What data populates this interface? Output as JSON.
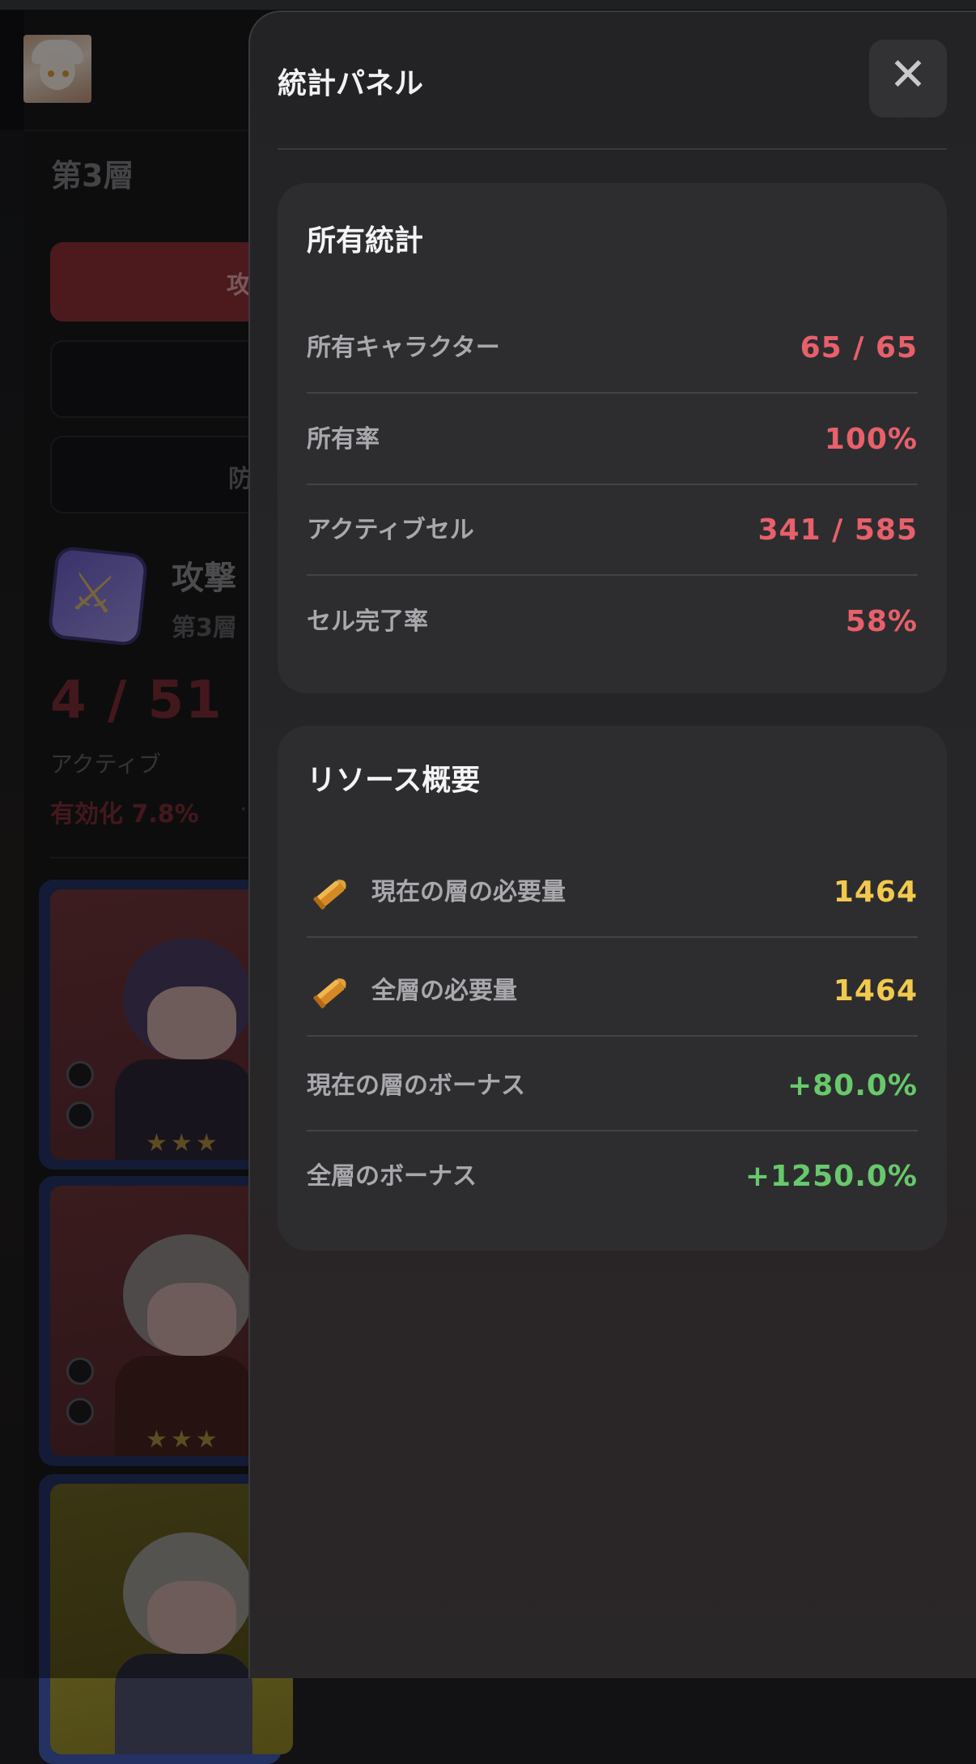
{
  "background": {
    "layer_title": "第3層",
    "buttons": [
      "攻",
      "",
      "防"
    ],
    "skill": {
      "name": "攻撃",
      "sub": "第3層"
    },
    "count": "4 / 51",
    "active_label": "アクティブ",
    "enabled_text": "有効化 7.8%",
    "enabled_sep": "·"
  },
  "panel": {
    "title": "統計パネル",
    "close_glyph": "✕",
    "ownership": {
      "title": "所有統計",
      "rows": [
        {
          "label": "所有キャラクター",
          "value": "65 / 65"
        },
        {
          "label": "所有率",
          "value": "100%"
        },
        {
          "label": "アクティブセル",
          "value": "341 / 585"
        },
        {
          "label": "セル完了率",
          "value": "58%"
        }
      ]
    },
    "resources": {
      "title": "リソース概要",
      "rows": [
        {
          "label": "現在の層の必要量",
          "value": "1464",
          "icon": "ammo-icon"
        },
        {
          "label": "全層の必要量",
          "value": "1464",
          "icon": "ammo-icon"
        },
        {
          "label": "現在の層のボーナス",
          "value": "+80.0%"
        },
        {
          "label": "全層のボーナス",
          "value": "+1250.0%"
        }
      ]
    }
  },
  "colors": {
    "accent_red": "#e8606a",
    "resource_yellow": "#f2c94c",
    "bonus_green": "#67c96b",
    "panel_bg": "#232326",
    "section_bg": "#2d2d30"
  }
}
